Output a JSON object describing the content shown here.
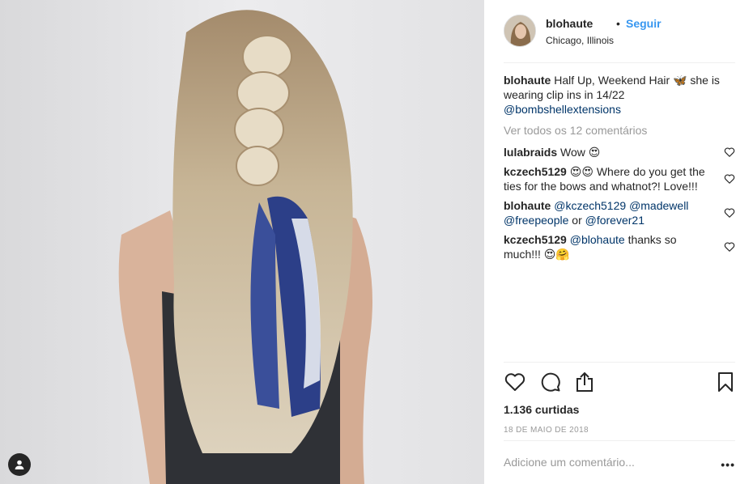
{
  "post": {
    "username": "blohaute",
    "separator": "•",
    "follow_label": "Seguir",
    "location": "Chicago, Illinois"
  },
  "caption": {
    "username": "blohaute",
    "text_before": "Half Up, Weekend Hair 🦋 she is wearing clip ins in 14/22",
    "mention": "@bombshellextensions"
  },
  "view_all_label": "Ver todos os 12 comentários",
  "comments": [
    {
      "username": "lulabraids",
      "text": "Wow 😍"
    },
    {
      "username": "kczech5129",
      "text": "😍😍 Where do you get the ties for the bows and whatnot?! Love!!!"
    },
    {
      "username": "blohaute",
      "mention1": "@kczech5129",
      "mention2": "@madewell",
      "mention3": "@freepeople",
      "or_text": "or",
      "mention4": "@forever21"
    },
    {
      "username": "kczech5129",
      "mention": "@blohaute",
      "text": "thanks so much!!! 😍🤗"
    }
  ],
  "likes_label": "1.136 curtidas",
  "date_label": "18 DE MAIO DE 2018",
  "add_comment_placeholder": "Adicione um comentário...",
  "more_label": "•••",
  "colors": {
    "link": "#3897f0",
    "mention": "#003569",
    "muted": "#999999"
  }
}
